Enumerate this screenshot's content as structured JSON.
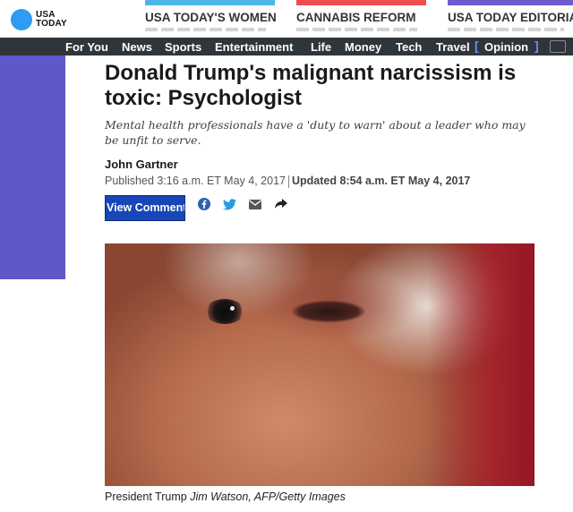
{
  "brand": {
    "logo_line1": "USA",
    "logo_line2": "TODAY"
  },
  "promos": [
    {
      "title": "USA TODAY'S WOMEN",
      "color": "#4db6e8"
    },
    {
      "title": "CANNABIS REFORM",
      "color": "#ef4d4d"
    },
    {
      "title": "USA TODAY EDITORIA",
      "color": "#6d5bd0"
    }
  ],
  "nav": {
    "items": [
      "For You",
      "News",
      "Sports",
      "Entertainment",
      "Life",
      "Money",
      "Tech",
      "Travel",
      "Opinion"
    ],
    "bracket_left": "[",
    "bracket_right": "]",
    "accent": "#6b8cff"
  },
  "article": {
    "headline": "Donald Trump's malignant narcissism is toxic: Psychologist",
    "deck": "Mental health professionals have a 'duty to warn' about a leader who may be unfit to serve.",
    "author": "John Gartner",
    "published": "Published 3:16 a.m. ET May 4, 2017",
    "updated": "Updated 8:54 a.m. ET May 4, 2017",
    "comments_label": "View Comments",
    "share_icons": [
      "facebook-icon",
      "twitter-icon",
      "email-icon",
      "share-arrow-icon"
    ],
    "caption_subject": "President Trump",
    "caption_credit": "Jim Watson, AFP/Getty Images"
  },
  "colors": {
    "side_panel": "#5e58c8",
    "comments_button": "#1746b8",
    "nav_bg": "#30353a"
  }
}
